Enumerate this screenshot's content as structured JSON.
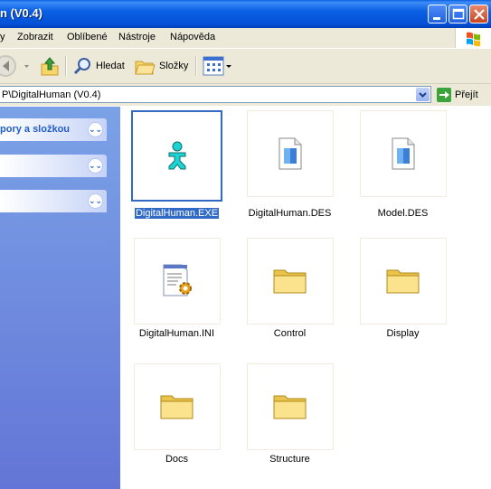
{
  "window": {
    "title": "n (V0.4)"
  },
  "menu": {
    "items": [
      "y",
      "Zobrazit",
      "Oblíbené",
      "Nástroje",
      "Nápověda"
    ]
  },
  "toolbar": {
    "search_label": "Hledat",
    "folders_label": "Složky"
  },
  "address": {
    "value": "P\\DigitalHuman (V0.4)",
    "go_label": "Přejít"
  },
  "taskpane": {
    "section1_title": "pory a složkou"
  },
  "files": [
    {
      "name": "DigitalHuman.EXE",
      "icon": "exe-person-icon",
      "selected": true
    },
    {
      "name": "DigitalHuman.DES",
      "icon": "generic-file-icon",
      "selected": false
    },
    {
      "name": "Model.DES",
      "icon": "generic-file-icon",
      "selected": false
    },
    {
      "name": "DigitalHuman.INI",
      "icon": "ini-settings-file-icon",
      "selected": false
    },
    {
      "name": "Control",
      "icon": "folder-icon",
      "selected": false
    },
    {
      "name": "Display",
      "icon": "folder-icon",
      "selected": false
    },
    {
      "name": "Docs",
      "icon": "folder-icon",
      "selected": false
    },
    {
      "name": "Structure",
      "icon": "folder-icon",
      "selected": false
    }
  ],
  "colors": {
    "titlebar": "#0A5FE0",
    "selection": "#316AC5",
    "taskpane": "#7BA2E7",
    "chrome": "#ECE9D8"
  }
}
